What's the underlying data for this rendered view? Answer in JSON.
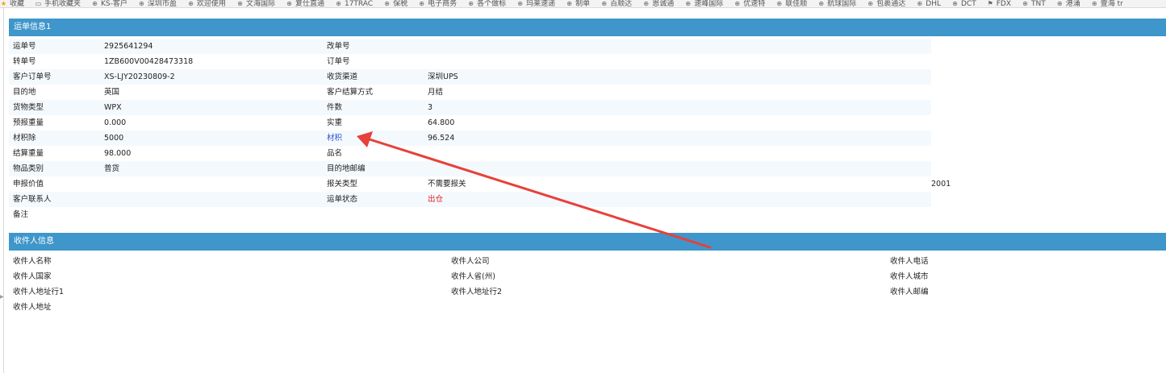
{
  "bookmarks": [
    {
      "icon": "star-icon",
      "label": "收藏"
    },
    {
      "icon": "folder-icon",
      "label": "手机收藏夹"
    },
    {
      "icon": "globe-icon",
      "label": "KS-客户"
    },
    {
      "icon": "globe-icon",
      "label": "深圳市盈"
    },
    {
      "icon": "globe-icon",
      "label": "欢迎使用"
    },
    {
      "icon": "globe-icon",
      "label": "文海国际"
    },
    {
      "icon": "globe-icon",
      "label": "复仕直通"
    },
    {
      "icon": "globe-icon",
      "label": "17TRAC"
    },
    {
      "icon": "globe-icon",
      "label": "保税"
    },
    {
      "icon": "globe-icon",
      "label": "电子商务"
    },
    {
      "icon": "globe-icon",
      "label": "各个做标"
    },
    {
      "icon": "globe-icon",
      "label": "玛莱速递"
    },
    {
      "icon": "globe-icon",
      "label": "制单"
    },
    {
      "icon": "globe-icon",
      "label": "百顺达"
    },
    {
      "icon": "globe-icon",
      "label": "恩诚通"
    },
    {
      "icon": "globe-icon",
      "label": "速峰国际"
    },
    {
      "icon": "globe-icon",
      "label": "优速特"
    },
    {
      "icon": "globe-icon",
      "label": "联佳顺"
    },
    {
      "icon": "globe-icon",
      "label": "航球国际"
    },
    {
      "icon": "globe-icon",
      "label": "包裹通达"
    },
    {
      "icon": "globe-icon",
      "label": "DHL"
    },
    {
      "icon": "globe-icon",
      "label": "DCT"
    },
    {
      "icon": "flag-icon",
      "label": "FDX"
    },
    {
      "icon": "globe-icon",
      "label": "TNT"
    },
    {
      "icon": "globe-icon",
      "label": "港涌"
    },
    {
      "icon": "globe-icon",
      "label": "壹海 tr"
    }
  ],
  "waybill_section": {
    "title": "运单信息1",
    "rows": [
      {
        "label1": "运单号",
        "value1": "2925641294",
        "label2": "改单号",
        "value2": "",
        "extra": ""
      },
      {
        "label1": "转单号",
        "value1": "1ZB600V00428473318",
        "label2": "订单号",
        "value2": "",
        "extra": ""
      },
      {
        "label1": "客户订单号",
        "value1": "XS-LJY20230809-2",
        "label2": "收货渠道",
        "value2": "深圳UPS",
        "extra": ""
      },
      {
        "label1": "目的地",
        "value1": "英国",
        "label2": "客户结算方式",
        "value2": "月结",
        "extra": ""
      },
      {
        "label1": "货物类型",
        "value1": "WPX",
        "label2": "件数",
        "value2": "3",
        "extra": ""
      },
      {
        "label1": "预报重量",
        "value1": "0.000",
        "label2": "实重",
        "value2": "64.800",
        "extra": ""
      },
      {
        "label1": "材积除",
        "value1": "5000",
        "label2": "材积",
        "value2": "96.524",
        "extra": ""
      },
      {
        "label1": "结算重量",
        "value1": "98.000",
        "label2": "品名",
        "value2": "",
        "extra": ""
      },
      {
        "label1": "物品类别",
        "value1": "普货",
        "label2": "目的地邮编",
        "value2": "",
        "extra": ""
      },
      {
        "label1": "申报价值",
        "value1": "",
        "label2": "报关类型",
        "value2": "不需要报关",
        "extra": "2001"
      },
      {
        "label1": "客户联系人",
        "value1": "",
        "label2": "运单状态",
        "value2": "出仓",
        "extra": ""
      },
      {
        "label1": "备注",
        "value1": "",
        "label2": "",
        "value2": "",
        "extra": ""
      }
    ]
  },
  "recipient_section": {
    "title": "收件人信息",
    "rows": [
      {
        "col1": "收件人名称",
        "col2": "收件人公司",
        "col3": "收件人电话"
      },
      {
        "col1": "收件人国家",
        "col2": "收件人省(州)",
        "col3": "收件人城市"
      },
      {
        "col1": "收件人地址行1",
        "col2": "收件人地址行2",
        "col3": "收件人邮编"
      },
      {
        "col1": "收件人地址",
        "col2": "",
        "col3": ""
      }
    ]
  },
  "colors": {
    "header_bg": "#3f96cb",
    "link": "#2a4fd0",
    "status_red": "#e02020",
    "annotation_arrow": "#e8403a"
  }
}
